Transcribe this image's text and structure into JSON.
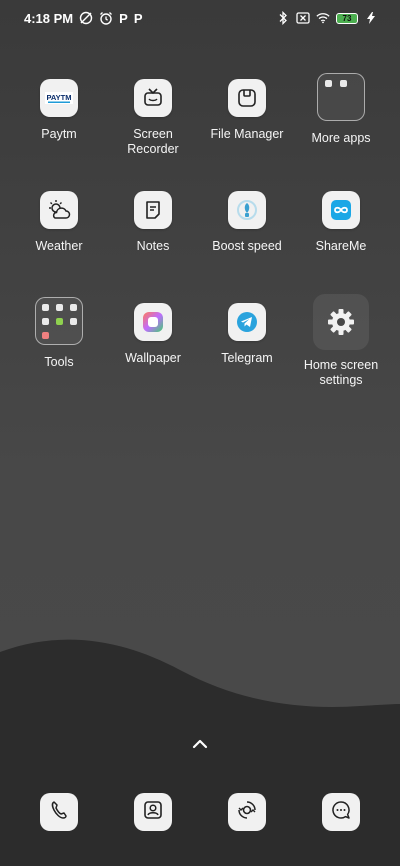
{
  "status_bar": {
    "time": "4:18 PM",
    "left_icons": [
      "dnd-icon",
      "alarm-icon",
      "p-app-icon",
      "p-app-icon"
    ],
    "right_icons": [
      "bluetooth-icon",
      "no-sim-icon",
      "wifi-icon",
      "battery-icon",
      "charging-icon"
    ],
    "battery_percent": "73",
    "p1": "P",
    "p2": "P"
  },
  "apps": [
    {
      "label": "Paytm",
      "icon": "paytm-icon"
    },
    {
      "label": "Screen Recorder",
      "icon": "screen-recorder-icon"
    },
    {
      "label": "File Manager",
      "icon": "file-manager-icon"
    },
    {
      "label": "More apps",
      "icon": "folder-icon"
    },
    {
      "label": "Weather",
      "icon": "weather-icon"
    },
    {
      "label": "Notes",
      "icon": "notes-icon"
    },
    {
      "label": "Boost speed",
      "icon": "boost-speed-icon"
    },
    {
      "label": "ShareMe",
      "icon": "shareme-icon"
    },
    {
      "label": "Tools",
      "icon": "folder-icon"
    },
    {
      "label": "Wallpaper",
      "icon": "wallpaper-icon"
    },
    {
      "label": "Telegram",
      "icon": "telegram-icon"
    },
    {
      "label": "Home screen settings",
      "icon": "gear-icon"
    }
  ],
  "paytm_logo_text": "Paytm",
  "dock": [
    {
      "name": "phone-icon"
    },
    {
      "name": "contacts-icon"
    },
    {
      "name": "camera-icon"
    },
    {
      "name": "messages-icon"
    }
  ],
  "colors": {
    "background": "#444444",
    "wave": "#2c2c2c",
    "battery": "#4caf50",
    "telegram": "#2aa3dd",
    "shareme": "#1ba7e6"
  }
}
